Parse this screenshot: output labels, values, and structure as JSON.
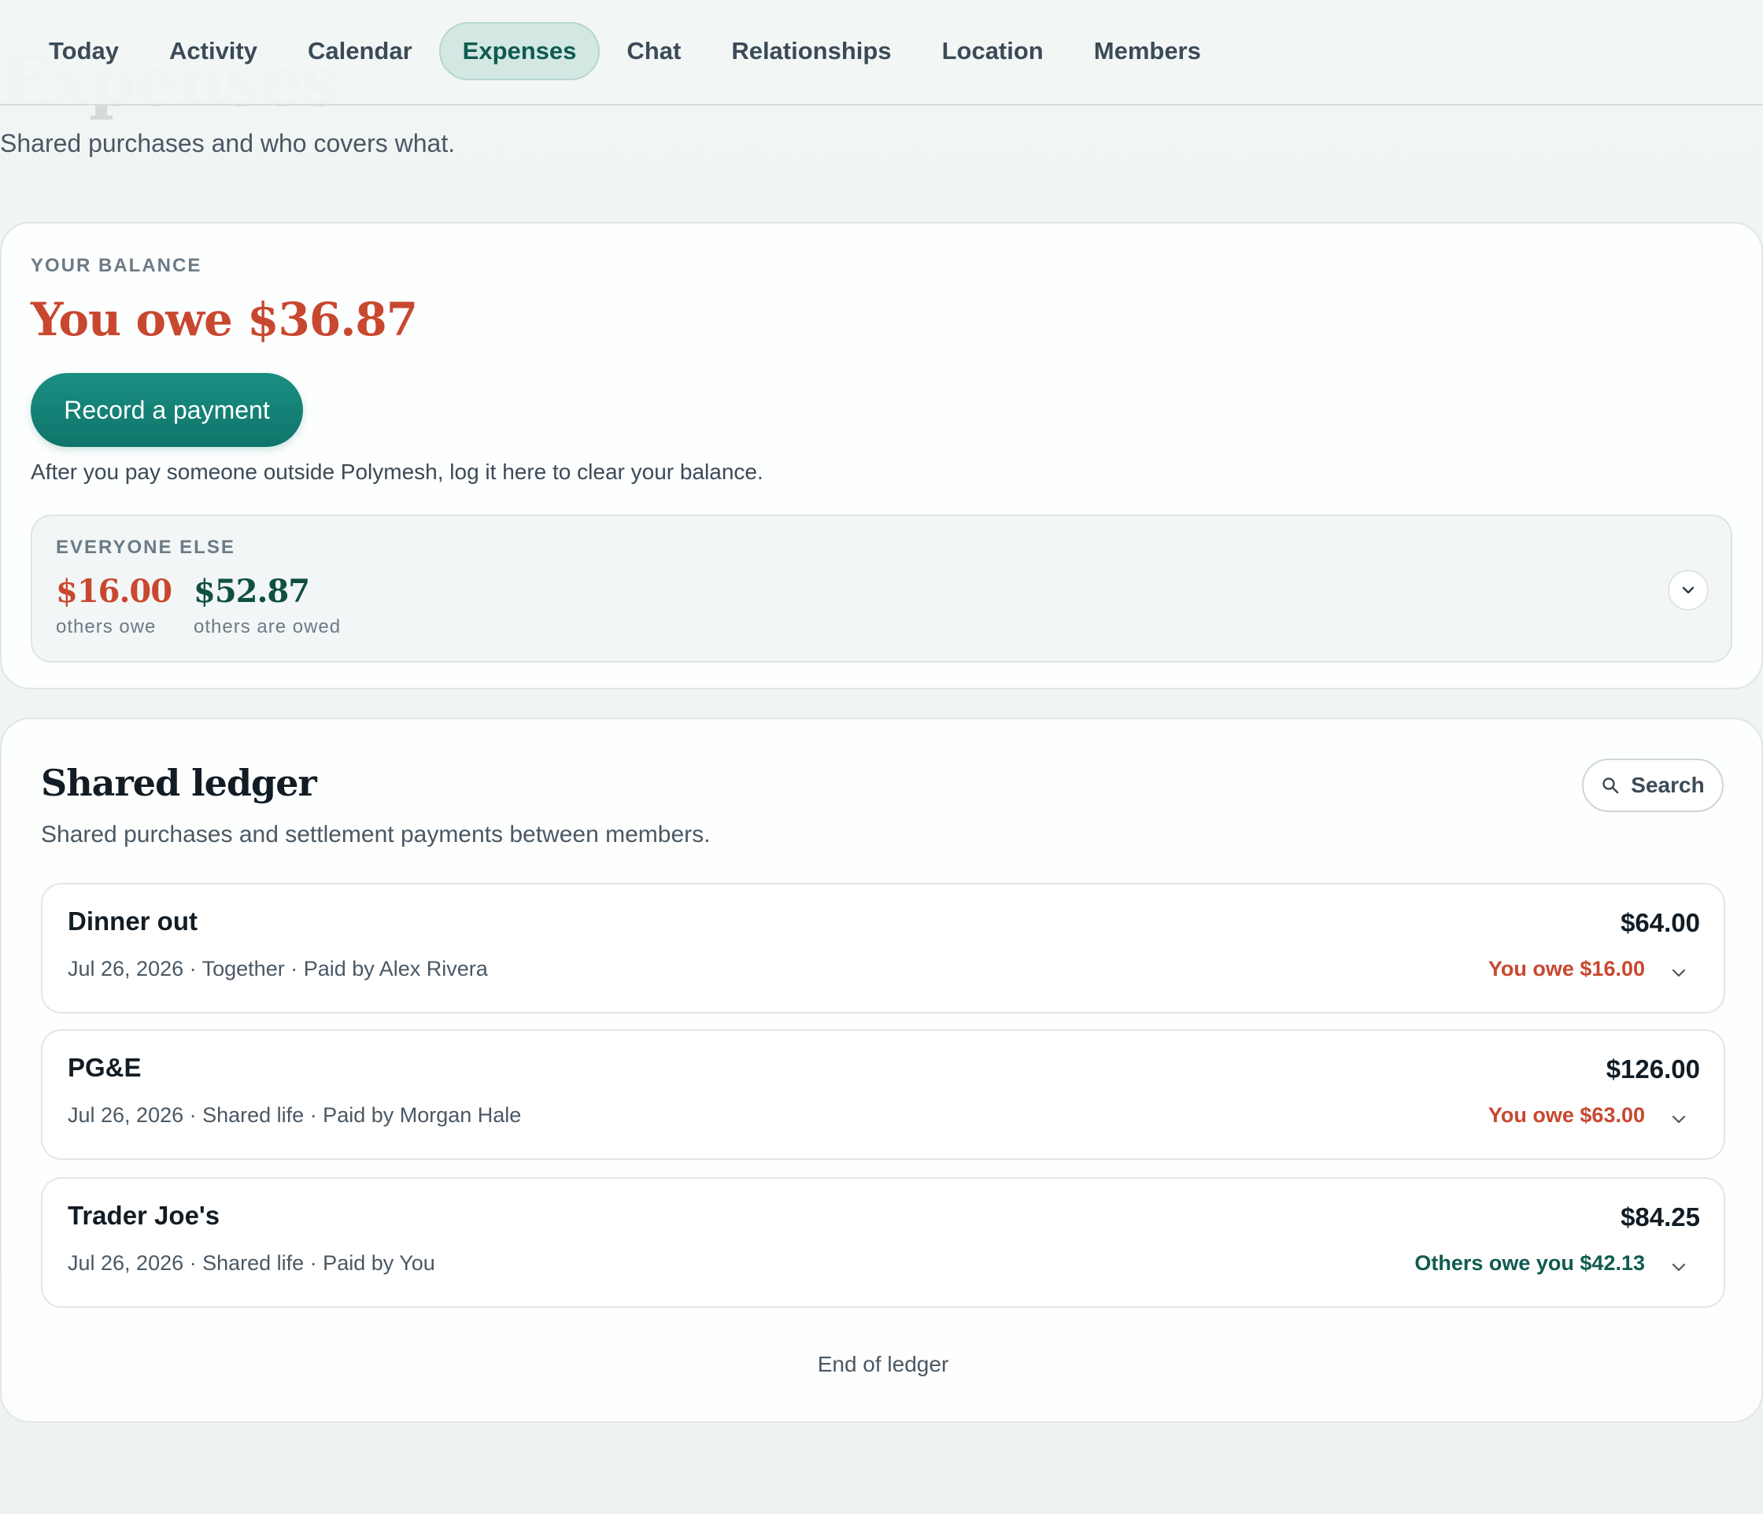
{
  "nav": {
    "tabs": [
      {
        "label": "Today"
      },
      {
        "label": "Activity"
      },
      {
        "label": "Calendar"
      },
      {
        "label": "Expenses",
        "active": true
      },
      {
        "label": "Chat"
      },
      {
        "label": "Relationships"
      },
      {
        "label": "Location"
      },
      {
        "label": "Members"
      }
    ]
  },
  "page": {
    "title": "Expenses",
    "subtitle": "Shared purchases and who covers what."
  },
  "balance": {
    "eyebrow": "YOUR BALANCE",
    "amount_text": "You owe $36.87",
    "record_button": "Record a payment",
    "help_text": "After you pay someone outside Polymesh, log it here to clear your balance.",
    "others": {
      "eyebrow": "EVERYONE ELSE",
      "owe_value": "$16.00",
      "owe_label": "others owe",
      "owed_value": "$52.87",
      "owed_label": "others are owed"
    }
  },
  "ledger": {
    "title": "Shared ledger",
    "subtitle": "Shared purchases and settlement payments between members.",
    "search_label": "Search",
    "entries": [
      {
        "name": "Dinner out",
        "meta": "Jul 26, 2026 · Together · Paid by Alex Rivera",
        "amount": "$64.00",
        "status": "You owe $16.00",
        "status_type": "owe"
      },
      {
        "name": "PG&E",
        "meta": "Jul 26, 2026 · Shared life · Paid by Morgan Hale",
        "amount": "$126.00",
        "status": "You owe $63.00",
        "status_type": "owe"
      },
      {
        "name": "Trader Joe's",
        "meta": "Jul 26, 2026 · Shared life · Paid by You",
        "amount": "$84.25",
        "status": "Others owe you $42.13",
        "status_type": "owed"
      }
    ],
    "end_note": "End of ledger"
  },
  "colors": {
    "accent": "#10756b",
    "owe": "#c8482f",
    "owed": "#0f5b4f"
  },
  "icons": {
    "search": "search-icon",
    "expand": "chevron-down-icon"
  }
}
